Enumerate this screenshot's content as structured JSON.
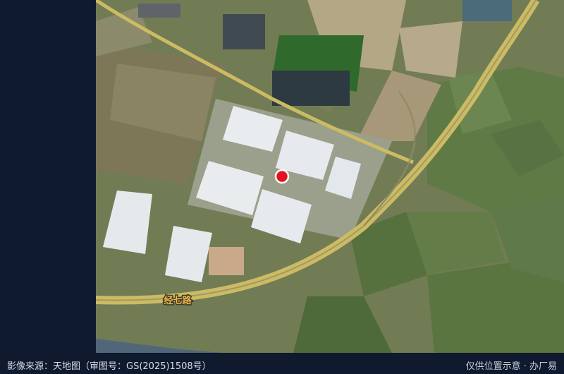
{
  "map": {
    "road_label": "经七路",
    "marker_color": "#e0141e",
    "road_color": "#d6c36a",
    "label_color": "#f2b94a"
  },
  "footer": {
    "source_text": "影像来源：天地图（审图号：GS(2025)1508号）",
    "note_text": "仅供位置示意 · 办厂易"
  }
}
